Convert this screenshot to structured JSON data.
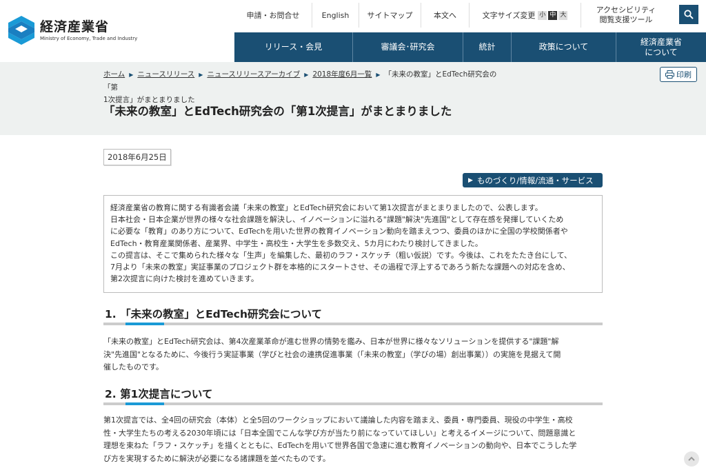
{
  "header": {
    "logo_jp": "経済産業省",
    "logo_en": "Ministry of Economy, Trade and Industry",
    "util": {
      "apply": "申請・お問合せ",
      "english": "English",
      "sitemap": "サイトマップ",
      "skip": "本文へ",
      "font_size_label": "文字サイズ変更",
      "font_small": "小",
      "font_medium": "中",
      "font_large": "大",
      "a11y_line1": "アクセシビリティ",
      "a11y_line2": "閲覧支援ツール"
    },
    "gnav": [
      {
        "label": "リリース・会見"
      },
      {
        "label": "審議会･研究会"
      },
      {
        "label": "統計"
      },
      {
        "label": "政策について"
      },
      {
        "label_line1": "経済産業省",
        "label_line2": "について"
      }
    ]
  },
  "breadcrumb": {
    "items": [
      "ホーム",
      "ニュースリリース",
      "ニュースリリースアーカイブ",
      "2018年度6月一覧"
    ],
    "current_line1": "「未来の教室」とEdTech研究会の「第",
    "current_line2": "1次提言」がまとまりました"
  },
  "print_label": "印刷",
  "page_title": "「未来の教室」とEdTech研究会の「第1次提言」がまとまりました",
  "date": "2018年6月25日",
  "category": "ものづくり/情報/流通・サービス",
  "summary_lines": [
    "経済産業省の教育に関する有識者会議「未来の教室」とEdTech研究会において第1次提言がまとまりましたので、公表します。",
    "日本社会・日本企業が世界の様々な社会課題を解決し、イノベーションに溢れる\"課題\"解決\"先進国\"として存在感を発揮していくため",
    "に必要な「教育」のあり方について、EdTechを用いた世界の教育イノベーション動向を踏まえつつ、委員のほかに全国の学校関係者や",
    "EdTech・教育産業関係者、産業界、中学生・高校生・大学生を多数交え、5カ月にわたり検討してきました。",
    "この提言は、そこで集められた様々な「生声」を編集した、最初のラフ・スケッチ（粗い仮説）です。今後は、これをたたき台にして、",
    "7月より「未来の教室」実証事業のプロジェクト群を本格的にスタートさせ、その過程で浮上するであろう新たな課題への対応を含め、",
    "第2次提言に向けた検討を進めていきます。"
  ],
  "section1": {
    "heading": "1. 「未来の教室」とEdTech研究会について",
    "lines": [
      "「未来の教室」とEdTech研究会は、第4次産業革命が進む世界の情勢を鑑み、日本が世界に様々なソリューションを提供する\"課題\"解",
      "決\"先進国\"となるために、今後行う実証事業（学びと社会の連携促進事業（「未来の教室」（学びの場）創出事業））の実施を見据えて開",
      "催したものです。"
    ]
  },
  "section2": {
    "heading": "2. 第1次提言について",
    "lines": [
      "第1次提言では、全4回の研究会（本体）と全5回のワークショップにおいて議論した内容を踏まえ、委員・専門委員、現役の中学生・高校",
      "性・大学生たちの考える2030年頃には「日本全国でこんな学び方が当たり前になっていてほしい」と考えるイメージについて、問題意識と",
      "理想を束ねた「ラフ・スケッチ」を描くとともに、EdTechを用いて世界各国で急速に進む教育イノベーションの動向や、日本でこうした学",
      "び方を実現するために解決が必要になる諸課題を並べたものです。"
    ]
  },
  "colors": {
    "brand": "#1a4f73",
    "accent": "#1a9ad6",
    "band": "#eef1f0"
  }
}
